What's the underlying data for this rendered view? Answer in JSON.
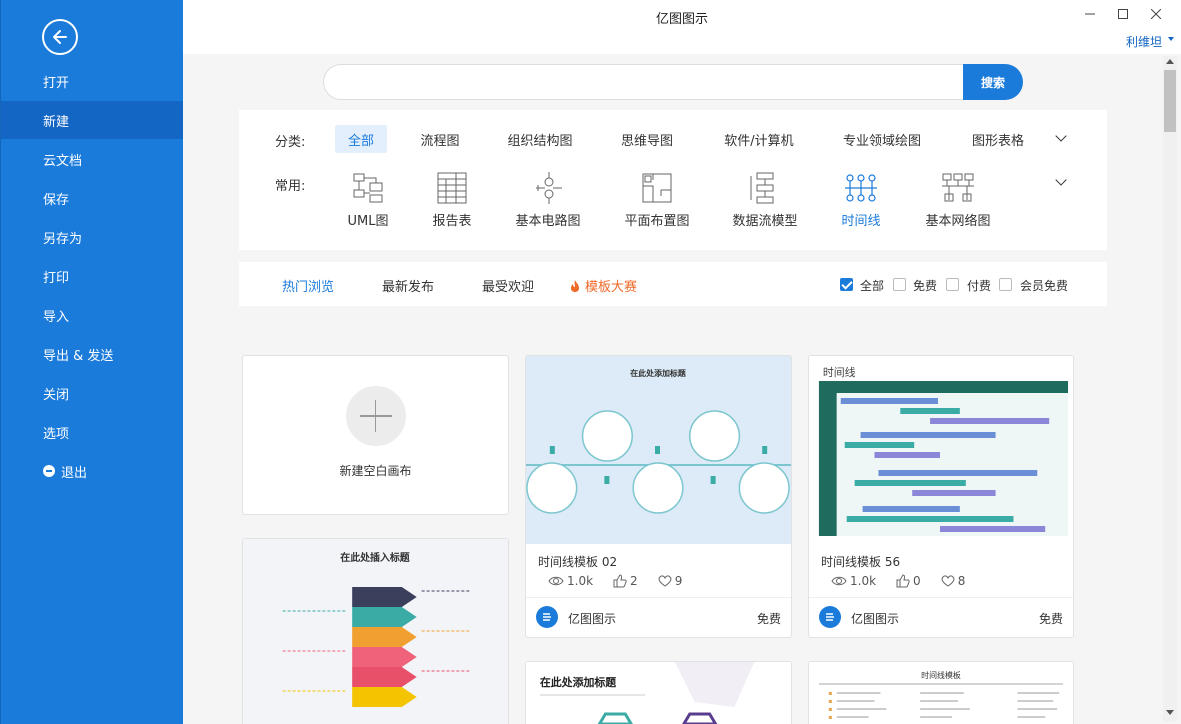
{
  "app": {
    "title": "亿图图示",
    "user": "利维坦"
  },
  "colors": {
    "primary": "#1b7bdb",
    "hot": "#f06a2b",
    "sidebar": "#1b7bdb"
  },
  "sidebar": {
    "back_icon": "back-arrow-icon",
    "items": [
      {
        "label": "打开"
      },
      {
        "label": "新建",
        "active": true
      },
      {
        "label": "云文档"
      },
      {
        "label": "保存"
      },
      {
        "label": "另存为"
      },
      {
        "label": "打印"
      },
      {
        "label": "导入"
      },
      {
        "label": "导出 & 发送"
      },
      {
        "label": "关闭"
      },
      {
        "label": "选项"
      },
      {
        "label": "退出",
        "icon": "minus-circle-icon"
      }
    ]
  },
  "search": {
    "placeholder": "",
    "button": "搜索"
  },
  "categories": {
    "label": "分类:",
    "tabs": [
      "全部",
      "流程图",
      "组织结构图",
      "思维导图",
      "软件/计算机",
      "专业领域绘图",
      "图形表格"
    ],
    "active": "全部"
  },
  "common": {
    "label": "常用:",
    "items": [
      {
        "label": "UML图",
        "icon": "uml-icon"
      },
      {
        "label": "报告表",
        "icon": "report-icon"
      },
      {
        "label": "基本电路图",
        "icon": "circuit-icon"
      },
      {
        "label": "平面布置图",
        "icon": "floorplan-icon"
      },
      {
        "label": "数据流模型",
        "icon": "dataflow-icon"
      },
      {
        "label": "时间线",
        "icon": "timeline-icon",
        "active": true
      },
      {
        "label": "基本网络图",
        "icon": "network-icon"
      }
    ]
  },
  "sort": {
    "tabs": [
      "热门浏览",
      "最新发布",
      "最受欢迎"
    ],
    "active": "热门浏览",
    "contest": "模板大赛",
    "filters": [
      {
        "label": "全部",
        "checked": true
      },
      {
        "label": "免费",
        "checked": false
      },
      {
        "label": "付费",
        "checked": false
      },
      {
        "label": "会员免费",
        "checked": false
      }
    ]
  },
  "new_blank": {
    "label": "新建空白画布"
  },
  "cards": [
    {
      "title": "时间线模板 02",
      "thumb_title": "在此处添加标题",
      "views": "1.0k",
      "likes": "2",
      "favorites": "9",
      "brand": "亿图图示",
      "price": "免费"
    },
    {
      "title": "时间线模板 56",
      "thumb_title": "时间线",
      "views": "1.0k",
      "likes": "0",
      "favorites": "8",
      "brand": "亿图图示",
      "price": "免费"
    }
  ],
  "preview_cards": [
    {
      "thumb_title": "在此处插入标题"
    },
    {
      "thumb_title": "在此处添加标题"
    },
    {
      "thumb_title": "时间线模板"
    }
  ]
}
